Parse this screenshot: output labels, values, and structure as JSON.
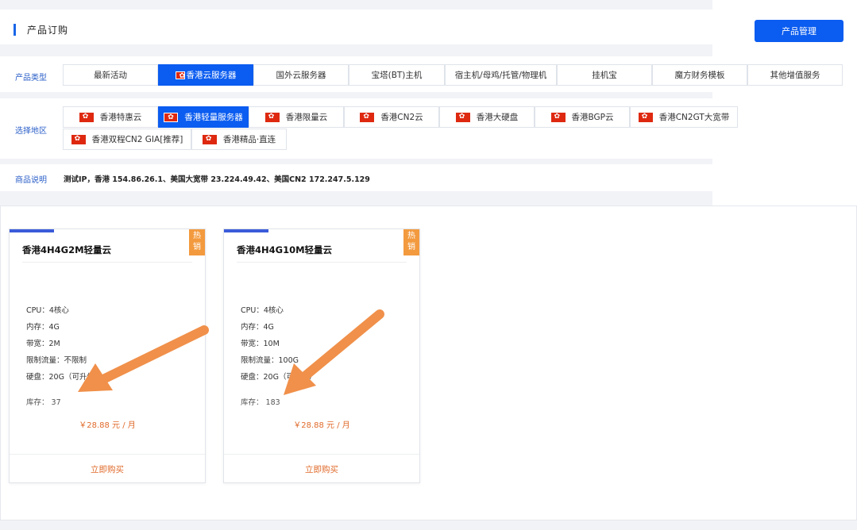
{
  "header": {
    "title": "产品订购",
    "manage_button": "产品管理"
  },
  "filters": {
    "type_label": "产品类型",
    "type_tabs": [
      "最新活动",
      "香港云服务器",
      "国外云服务器",
      "宝塔(BT)主机",
      "宿主机/母鸡/托管/物理机",
      "挂机宝",
      "魔方财务模板",
      "其他增值服务"
    ],
    "region_label": "选择地区",
    "region_tabs": [
      "香港特惠云",
      "香港轻量服务器",
      "香港限量云",
      "香港CN2云",
      "香港大硬盘",
      "香港BGP云",
      "香港CN2GT大宽带",
      "香港双程CN2 GIA[推荐]",
      "香港精品·直连"
    ],
    "desc_label": "商品说明",
    "desc_text": "测试IP，香港 154.86.26.1、美国大宽带 23.224.49.42、美国CN2 172.247.5.129"
  },
  "products": [
    {
      "badge": "热\n销",
      "name": "香港4H4G2M轻量云",
      "specs": [
        "CPU：4核心",
        "内存：4G",
        "带宽：2M",
        "限制流量：不限制",
        "硬盘：20G（可升级）"
      ],
      "stock": "库存：  37",
      "price": "￥28.88 元 / 月",
      "buy": "立即购买"
    },
    {
      "badge": "热\n销",
      "name": "香港4H4G10M轻量云",
      "specs": [
        "CPU：4核心",
        "内存：4G",
        "带宽：10M",
        "限制流量：100G",
        "硬盘：20G（可升级）"
      ],
      "stock": "库存：  183",
      "price": "￥28.88 元 / 月",
      "buy": "立即购买"
    }
  ],
  "colors": {
    "accent": "#0b5cf0",
    "price": "#e06a2a",
    "hot_badge": "#f39a3e",
    "arrow": "#f0904a"
  }
}
